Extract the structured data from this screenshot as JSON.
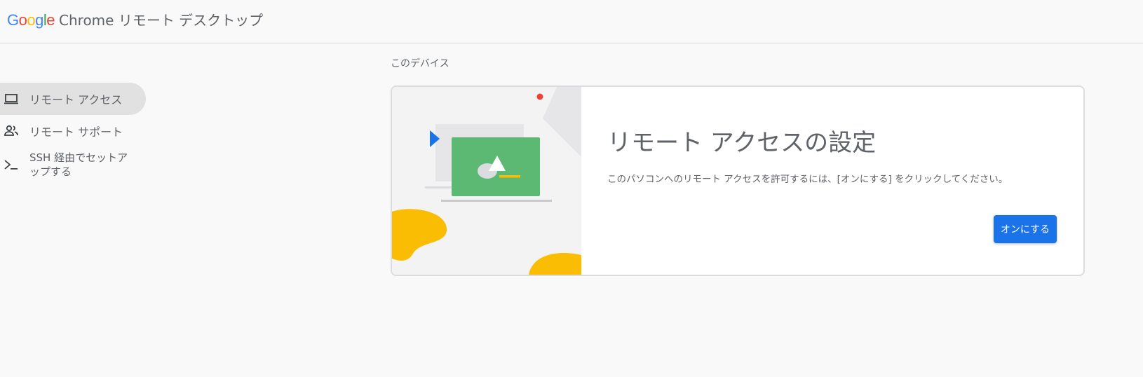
{
  "header": {
    "logo_letters": [
      "G",
      "o",
      "o",
      "g",
      "l",
      "e"
    ],
    "product_name": "Chrome リモート デスクトップ"
  },
  "nav": {
    "items": [
      {
        "label": "リモート アクセス",
        "icon": "laptop-icon",
        "active": true
      },
      {
        "label": "リモート サポート",
        "icon": "people-icon",
        "active": false
      },
      {
        "label": "SSH 経由でセットアップする",
        "icon": "terminal-icon",
        "active": false
      }
    ]
  },
  "main": {
    "section_label": "このデバイス",
    "card": {
      "title": "リモート アクセスの設定",
      "description": "このパソコンへのリモート アクセスを許可するには、[オンにする] をクリックしてください。",
      "button_label": "オンにする"
    }
  },
  "colors": {
    "accent": "#1a73e8",
    "illustration_green": "#5bb974",
    "illustration_yellow": "#fbbc04",
    "illustration_red": "#ea4335"
  }
}
